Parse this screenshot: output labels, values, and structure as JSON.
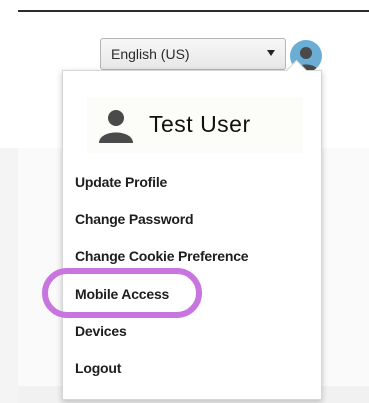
{
  "language_select": {
    "selected": "English (US)"
  },
  "user": {
    "name": "Test User"
  },
  "menu": {
    "items": [
      {
        "label": "Update Profile"
      },
      {
        "label": "Change Password"
      },
      {
        "label": "Change Cookie Preference"
      },
      {
        "label": "Mobile Access"
      },
      {
        "label": "Devices"
      },
      {
        "label": "Logout"
      }
    ]
  },
  "icons": {
    "avatar": "user-avatar-icon",
    "user": "person-icon",
    "caret": "caret-down-icon"
  },
  "colors": {
    "highlight": "#c875e0",
    "avatar_bg": "#6aaed6",
    "avatar_figure": "#4a4a4a"
  }
}
